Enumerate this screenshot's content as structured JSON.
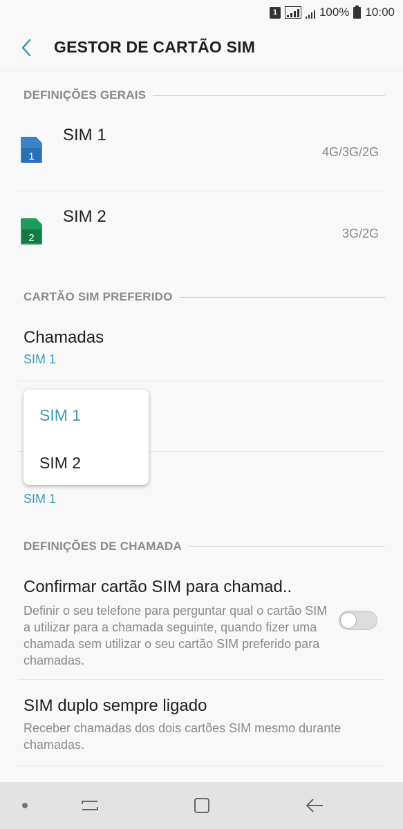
{
  "status_bar": {
    "sim_indicator": "1",
    "battery": "100%",
    "time": "10:00",
    "icons": [
      "sim-1-icon",
      "signal-boxed-icon",
      "signal-icon",
      "battery-icon"
    ]
  },
  "header": {
    "title": "GESTOR DE CARTÃO SIM",
    "back_icon": "chevron-left-icon"
  },
  "colors": {
    "accent": "#3d9bb6",
    "sim1": "#3b83c8",
    "sim2": "#1b9c5a",
    "secondary_text": "#8a8a8a"
  },
  "sections": {
    "general": "DEFINIÇÕES GERAIS",
    "preferred": "CARTÃO SIM PREFERIDO",
    "call_settings": "DEFINIÇÕES DE CHAMADA"
  },
  "sims": [
    {
      "name": "SIM 1",
      "badge": "1",
      "network": "4G/3G/2G"
    },
    {
      "name": "SIM 2",
      "badge": "2",
      "network": "3G/2G"
    }
  ],
  "preferred": {
    "calls_title": "Chamadas",
    "calls_value": "SIM 1",
    "second_value": "SIM 1"
  },
  "popup": {
    "options": [
      "SIM 1",
      "SIM 2"
    ],
    "selected": "SIM 1"
  },
  "call_settings": {
    "confirm_title": "Confirmar cartão SIM para chamad..",
    "confirm_desc": "Definir o seu telefone para perguntar qual o cartão SIM a utilizar para a chamada seguinte, quando fizer uma chamada sem utilizar o seu cartão SIM preferido para chamadas.",
    "confirm_toggle": false,
    "dual_title": "SIM duplo sempre ligado",
    "dual_desc": "Receber chamadas dos dois cartões SIM mesmo durante chamadas."
  },
  "nav_bar": {
    "icons": [
      "nav-dot-icon",
      "recents-icon",
      "home-icon",
      "back-icon"
    ]
  }
}
